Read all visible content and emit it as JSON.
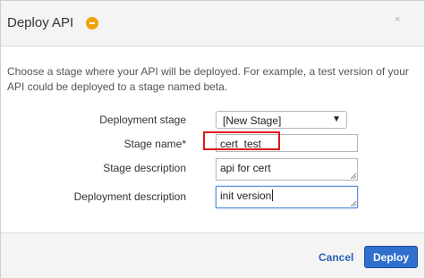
{
  "dialog": {
    "title": "Deploy API",
    "close_glyph": "×",
    "intro_text": "Choose a stage where your API will be deployed. For example, a test version of your API could be deployed to a stage named beta."
  },
  "form": {
    "deployment_stage_label": "Deployment stage",
    "deployment_stage_value": "[New Stage]",
    "stage_name_label": "Stage name*",
    "stage_name_value": "cert_test",
    "stage_description_label": "Stage description",
    "stage_description_value": "api for cert",
    "deployment_description_label": "Deployment description",
    "deployment_description_value": "init version"
  },
  "footer": {
    "cancel_label": "Cancel",
    "deploy_label": "Deploy"
  },
  "colors": {
    "primary_button": "#2f6fce",
    "link": "#2a63b5",
    "highlight_border": "#e3141b",
    "badge": "#f0a30a"
  }
}
